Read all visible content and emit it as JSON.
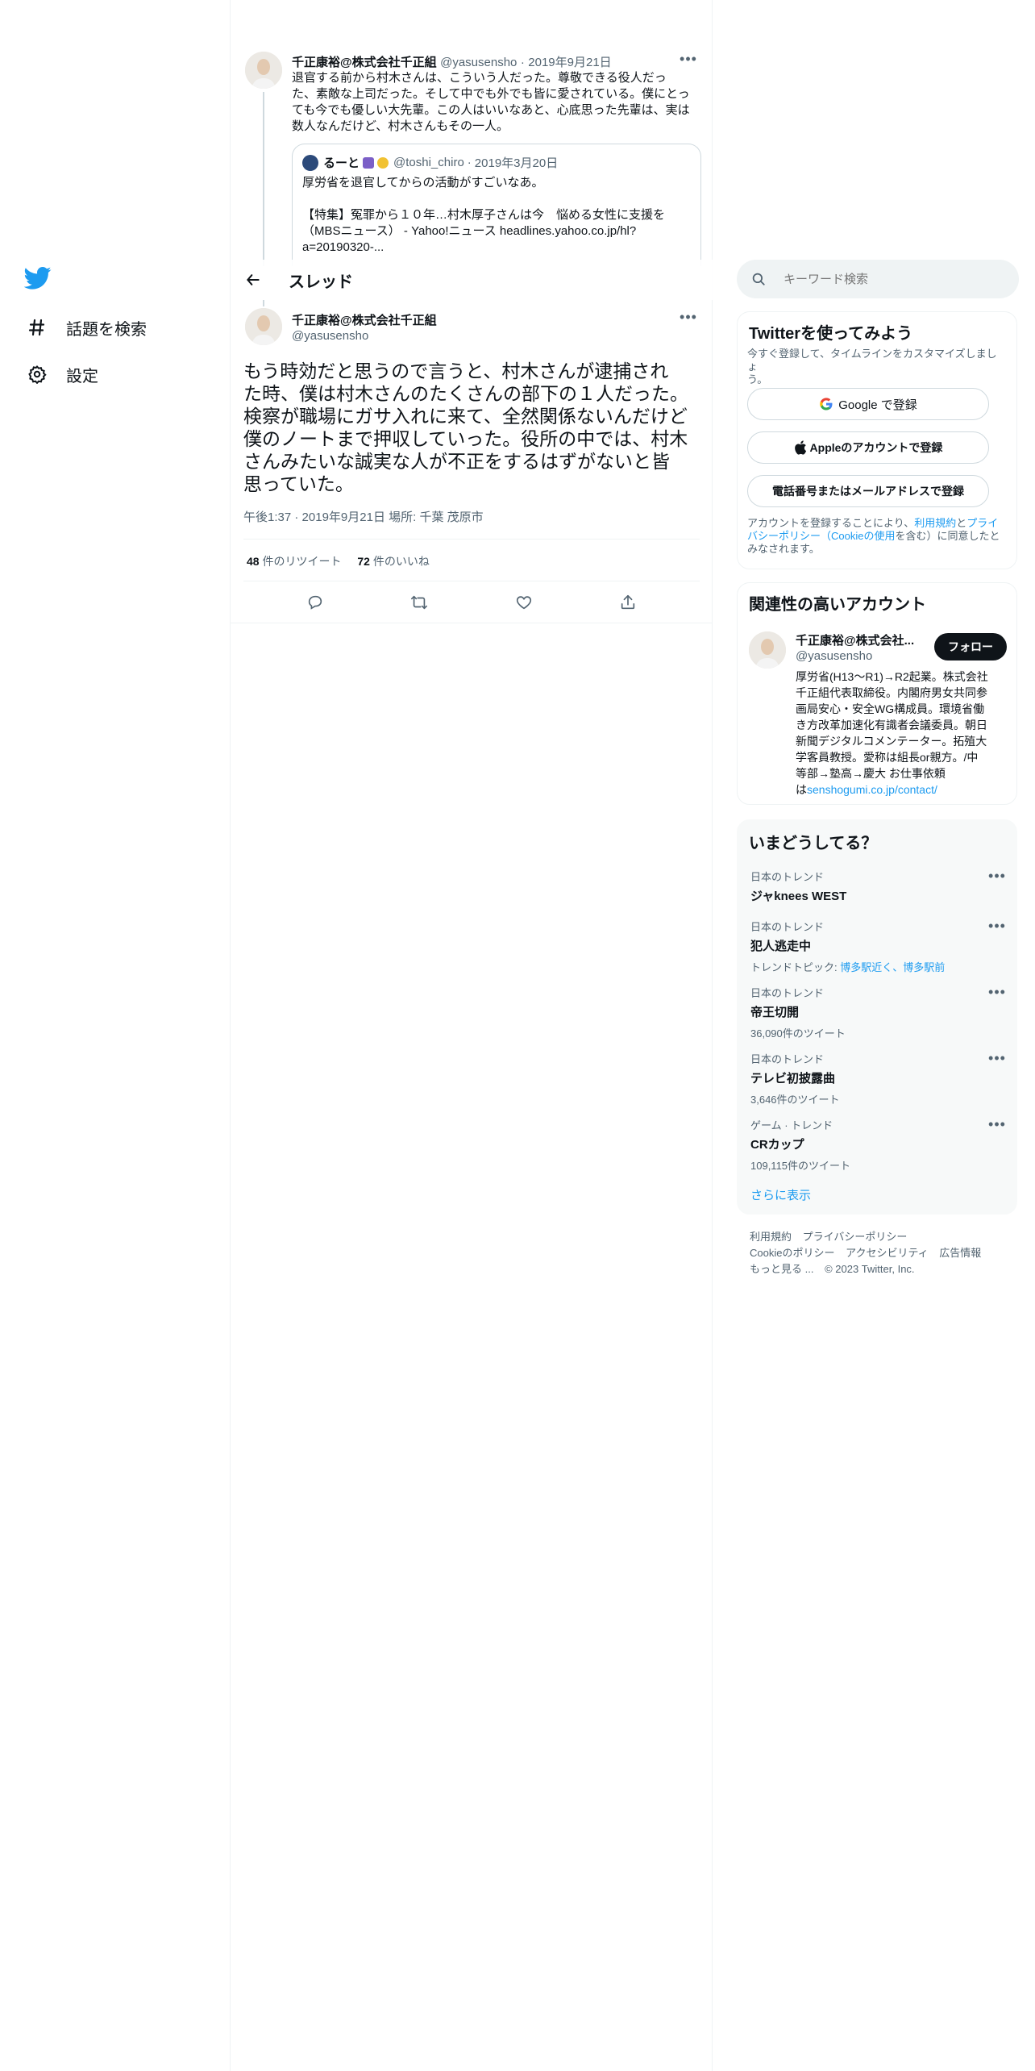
{
  "nav": {
    "logo_icon": "twitter-bird-icon",
    "items": [
      {
        "icon": "hashtag-icon",
        "label": "話題を検索"
      },
      {
        "icon": "gear-icon",
        "label": "設定"
      }
    ]
  },
  "header": {
    "title": "スレッド",
    "back_icon": "arrow-left-icon"
  },
  "parent_tweet": {
    "name": "千正康裕@株式会社千正組",
    "handle": "@yasusensho",
    "date": "2019年9月21日",
    "text_lines": [
      "退官する前から村木さんは、こういう人だった。尊敬できる役人だっ",
      "た、素敵な上司だった。そして中でも外でも皆に愛されている。僕にとっ",
      "ても今でも優しい大先輩。この人はいいなあと、心底思った先輩は、実は",
      "数人なんだけど、村木さんもその一人。"
    ],
    "quote": {
      "name": "るーと",
      "handle": "@toshi_chiro",
      "date": "2019年3月20日",
      "lines": [
        "厚労省を退官してからの活動がすごいなあ。",
        "",
        "【特集】冤罪から１０年…村木厚子さんは今　悩める女性に支援を",
        "（MBSニュース） - Yahoo!ニュース headlines.yahoo.co.jp/hl?",
        "a=20190320-..."
      ]
    }
  },
  "main_tweet": {
    "name": "千正康裕@株式会社千正組",
    "handle": "@yasusensho",
    "text_lines": [
      "もう時効だと思うので言うと、村木さんが逮捕され",
      "た時、僕は村木さんのたくさんの部下の１人だった。",
      "検察が職場にガサ入れに来て、全然関係ないんだけど",
      "僕のノートまで押収していった。役所の中では、村木",
      "さんみたいな誠実な人が不正をするはずがないと皆",
      "思っていた。"
    ],
    "time": "午後1:37",
    "date": "2019年9月21日",
    "location_prefix": "場所:",
    "location": "千葉 茂原市",
    "retweets": "48",
    "retweets_label": "件のリツイート",
    "likes": "72",
    "likes_label": "件のいいね",
    "actions": [
      "reply-icon",
      "retweet-icon",
      "like-icon",
      "share-icon"
    ]
  },
  "search": {
    "placeholder": "キーワード検索"
  },
  "signup": {
    "title": "Twitterを使ってみよう",
    "subtitle_lines": [
      "今すぐ登録して、タイムラインをカスタマイズしましょ",
      "う。"
    ],
    "google_btn": "Google で登録",
    "apple_btn": "Appleのアカウントで登録",
    "phone_btn": "電話番号またはメールアドレスで登録",
    "legal": {
      "pre": "アカウントを登録することにより、",
      "terms": "利用規約",
      "mid": "と",
      "privacy_a": "プライ",
      "privacy_b": "バシーポリシー",
      "cookie": "（Cookieの使用",
      "post_a": "を含む）に同意したと",
      "post_b": "みなされます。"
    }
  },
  "related": {
    "title": "関連性の高いアカウント",
    "name": "千正康裕@株式会社...",
    "handle": "@yasusensho",
    "follow": "フォロー",
    "bio_lines": [
      "厚労省(H13～R1)→R2起業。株式会社",
      "千正組代表取締役。内閣府男女共同参",
      "画局安心・安全WG構成員。環境省働",
      "き方改革加速化有識者会議委員。朝日",
      "新聞デジタルコメンテーター。拓殖大",
      "学客員教授。愛称は組長or親方。/中",
      "等部→塾高→慶大 お仕事依頼"
    ],
    "bio_link_pre": "は",
    "bio_link": "senshogumi.co.jp/contact/"
  },
  "trends": {
    "title": "いまどうしてる？",
    "items": [
      {
        "category": "日本のトレンド",
        "name": "ジャknees WEST",
        "extra": ""
      },
      {
        "category": "日本のトレンド",
        "name": "犯人逃走中",
        "topic_label": "トレンドトピック:",
        "topic": "博多駅近く、博多駅前"
      },
      {
        "category": "日本のトレンド",
        "name": "帝王切開",
        "extra": "36,090件のツイート"
      },
      {
        "category": "日本のトレンド",
        "name": "テレビ初披露曲",
        "extra": "3,646件のツイート"
      },
      {
        "category": "ゲーム · トレンド",
        "name": "CRカップ",
        "extra": "109,115件のツイート"
      }
    ],
    "show_more": "さらに表示"
  },
  "footer": {
    "terms": "利用規約",
    "privacy": "プライバシーポリシー",
    "cookie": "Cookieのポリシー",
    "accessibility": "アクセシビリティ",
    "ads": "広告情報",
    "more": "もっと見る ...",
    "copyright": "© 2023 Twitter, Inc."
  },
  "colors": {
    "accent": "#1d9bf0",
    "text": "#0f1419",
    "muted": "#536471",
    "border": "#eff3f4"
  }
}
